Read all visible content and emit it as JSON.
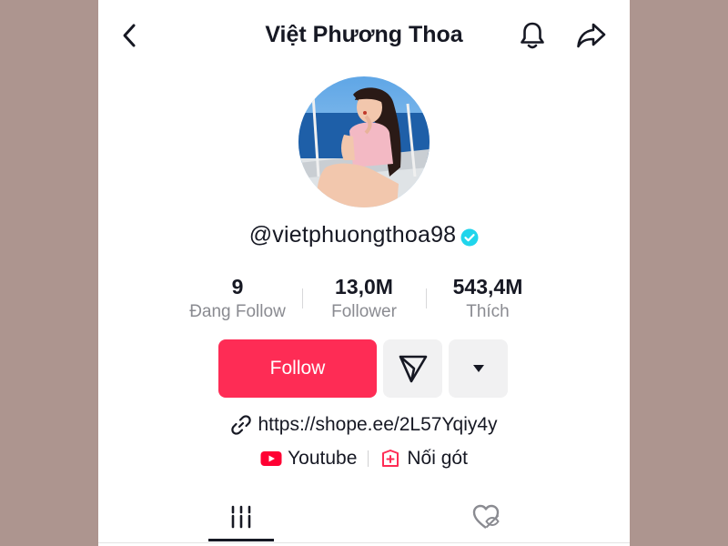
{
  "header": {
    "title": "Việt Phương Thoa",
    "back_icon": "chevron-left-icon",
    "bell_icon": "bell-icon",
    "share_icon": "share-arrow-icon"
  },
  "profile": {
    "username": "@vietphuongthoa98",
    "verified": true
  },
  "stats": {
    "following": {
      "value": "9",
      "label": "Đang Follow"
    },
    "followers": {
      "value": "13,0M",
      "label": "Follower"
    },
    "likes": {
      "value": "543,4M",
      "label": "Thích"
    }
  },
  "actions": {
    "follow_label": "Follow",
    "message_icon": "send-message-icon",
    "more_icon": "caret-down-icon"
  },
  "bio": {
    "link": "https://shope.ee/2L57Yqiy4y",
    "socials": [
      {
        "label": "Youtube",
        "icon": "youtube-icon"
      },
      {
        "label": "Nối gót",
        "icon": "add-friend-icon"
      }
    ]
  },
  "tabs": [
    {
      "icon": "videos-grid-icon",
      "active": true
    },
    {
      "icon": "liked-hidden-icon",
      "active": false
    }
  ],
  "colors": {
    "accent": "#fe2c55",
    "verified": "#20d5ec",
    "background": "#ad958f",
    "text": "#161823",
    "muted": "#8a8b91"
  }
}
